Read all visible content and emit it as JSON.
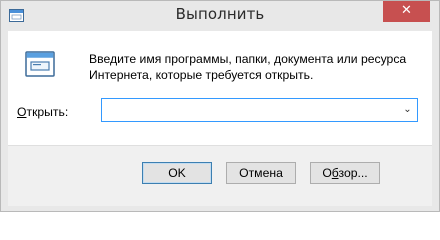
{
  "window": {
    "title": "Выполнить",
    "close_glyph": "✕",
    "accent_close_color": "#c75050"
  },
  "dialog": {
    "icon": "run-app-icon",
    "description_line1": "Введите имя программы, папки, документа или ресурса",
    "description_line2": "Интернета, которые требуется открыть.",
    "open_label_mnemonic": "О",
    "open_label_rest": "ткрыть:",
    "open_value": "",
    "dropdown_glyph": "⌄"
  },
  "buttons": {
    "ok": "OK",
    "cancel": "Отмена",
    "browse_mnemonic": "б",
    "browse_prefix": "О",
    "browse_suffix": "зор..."
  }
}
